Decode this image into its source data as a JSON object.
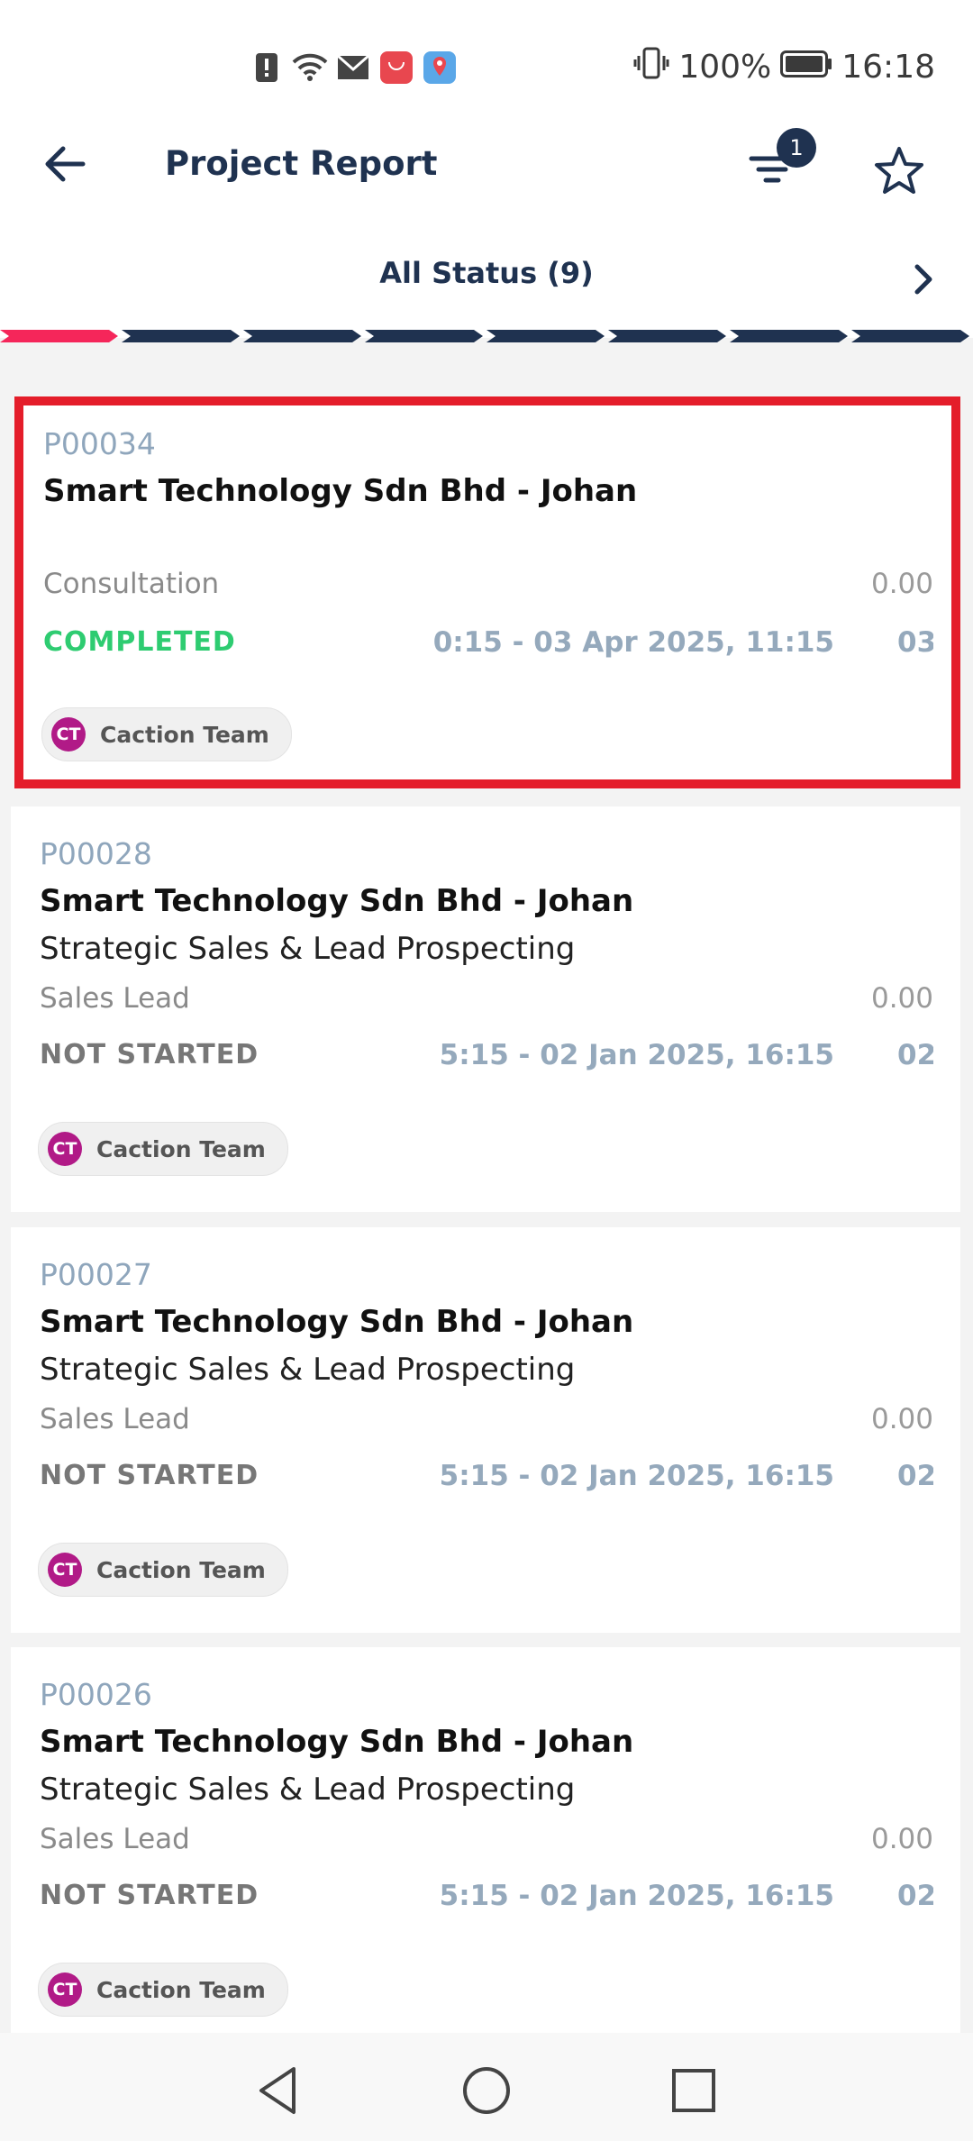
{
  "status_bar": {
    "battery": "100%",
    "time": "16:18",
    "icons": [
      "alert-icon",
      "wifi-icon",
      "mail-icon",
      "huawei-app-icon",
      "maps-icon",
      "vibrate-icon",
      "battery-icon"
    ]
  },
  "header": {
    "title": "Project Report",
    "filter_badge": "1",
    "status_filter": "All Status (9)",
    "progress_segments": 8,
    "active_segment": 0,
    "colors": {
      "active": "#f5265a",
      "inactive": "#1f3250"
    }
  },
  "projects": [
    {
      "id": "P00034",
      "name": "Smart Technology Sdn Bhd - Johan",
      "description": "",
      "type": "Consultation",
      "value": "0.00",
      "status": "COMPLETED",
      "status_color": "#2ecc71",
      "time": "0:15 - 03 Apr 2025, 11:15",
      "extra": "03",
      "team_initials": "CT",
      "team": "Caction Team"
    },
    {
      "id": "P00028",
      "name": "Smart Technology Sdn Bhd - Johan",
      "description": "Strategic Sales & Lead Prospecting",
      "type": "Sales Lead",
      "value": "0.00",
      "status": "NOT STARTED",
      "status_color": "#777777",
      "time": "5:15 - 02 Jan 2025, 16:15",
      "extra": "02",
      "team_initials": "CT",
      "team": "Caction Team"
    },
    {
      "id": "P00027",
      "name": "Smart Technology Sdn Bhd - Johan",
      "description": "Strategic Sales & Lead Prospecting",
      "type": "Sales Lead",
      "value": "0.00",
      "status": "NOT STARTED",
      "status_color": "#777777",
      "time": "5:15 - 02 Jan 2025, 16:15",
      "extra": "02",
      "team_initials": "CT",
      "team": "Caction Team"
    },
    {
      "id": "P00026",
      "name": "Smart Technology Sdn Bhd - Johan",
      "description": "Strategic Sales & Lead Prospecting",
      "type": "Sales Lead",
      "value": "0.00",
      "status": "NOT STARTED",
      "status_color": "#777777",
      "time": "5:15 - 02 Jan 2025, 16:15",
      "extra": "02",
      "team_initials": "CT",
      "team": "Caction Team"
    }
  ],
  "nav": {
    "icons": [
      "back-triangle-icon",
      "home-circle-icon",
      "recents-square-icon"
    ]
  }
}
